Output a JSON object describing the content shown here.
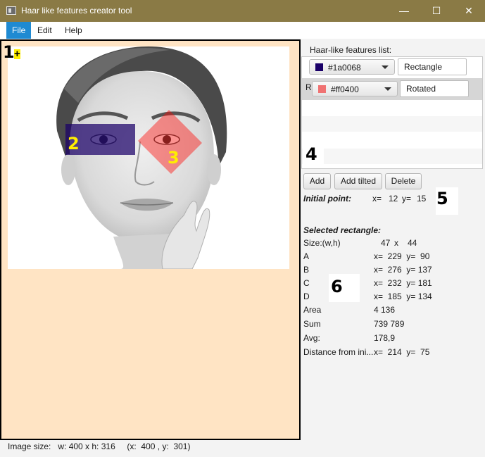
{
  "window": {
    "title": "Haar like features creator tool",
    "controls": {
      "minimize": "—",
      "maximize": "☐",
      "close": "✕"
    }
  },
  "menu": {
    "file": "File",
    "edit": "Edit",
    "help": "Help"
  },
  "canvas": {
    "markers": {
      "m1": "1",
      "m1_cross": "+",
      "m2": "2",
      "m3": "3"
    },
    "colors": {
      "background": "#ffe4c4",
      "marker_yellow": "#ffee00"
    }
  },
  "status": {
    "text": "Image size:   w: 400 x h: 316     (x:  400 , y:  301)"
  },
  "features": {
    "label": "Haar-like features list:",
    "items": [
      {
        "color_hex": "#1a0068",
        "color_label": "#1a0068",
        "type": "Rectangle"
      },
      {
        "color_hex": "#ff0400",
        "color_label": "#ff0400",
        "type": "Rotated",
        "row_prefix": "R"
      }
    ],
    "annotation": "4"
  },
  "buttons": {
    "add": "Add",
    "add_tilted": "Add tilted",
    "delete": "Delete"
  },
  "initial_point": {
    "label": "Initial point:",
    "x_label": "x=",
    "x": "12",
    "y_label": "y=",
    "y": "15",
    "annotation": "5"
  },
  "selected": {
    "heading": "Selected rectangle:",
    "size_label": "Size:(w,h)",
    "w": "47",
    "x_sep": "x",
    "h": "44",
    "a_label": "A",
    "a_value": "x=  229  y=  90",
    "b_label": "B",
    "b_value": "x=  276  y= 137",
    "c_label": "C",
    "c_value": "x=  232  y= 181",
    "d_label": "D",
    "d_value": "x=  185  y= 134",
    "area_label": "Area",
    "area_value": "4 136",
    "sum_label": "Sum",
    "sum_value": "739 789",
    "avg_label": "Avg:",
    "avg_value": "178,9",
    "dist_label": "Distance from ini...",
    "dist_value": "x=  214  y=  75",
    "annotation": "6"
  }
}
